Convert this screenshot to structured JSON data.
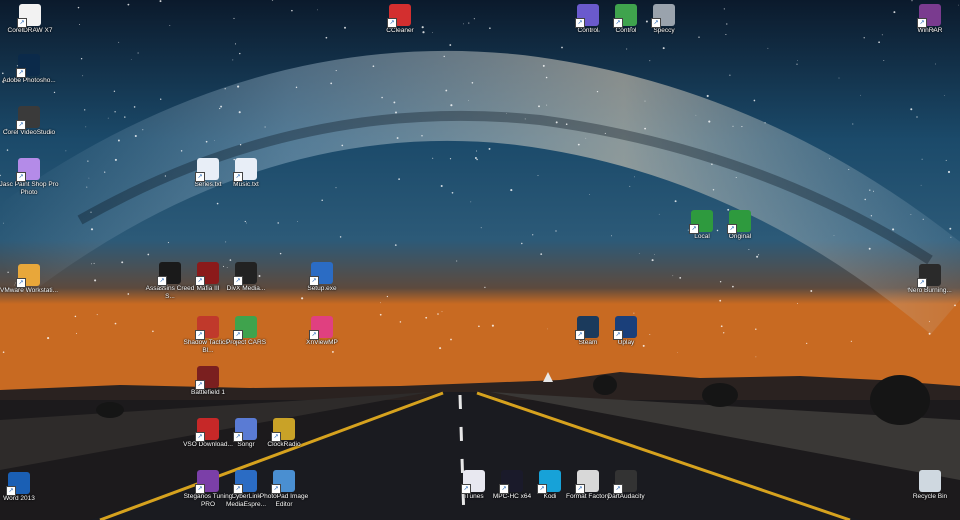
{
  "desktop": {
    "icons": [
      {
        "id": "coreldraw",
        "label": "CorelDRAW X7",
        "glyph": "document-icon",
        "color": "#f2f2f2"
      },
      {
        "id": "photoshop",
        "label": "Adobe Photosho...",
        "glyph": "photoshop-icon",
        "color": "#0b2a4a"
      },
      {
        "id": "videostudio",
        "label": "Corel VideoStudio",
        "glyph": "camera-icon",
        "color": "#3a3a3a"
      },
      {
        "id": "jasc",
        "label": "Jasc Paint Shop Pro Photo",
        "glyph": "sphere-icon",
        "color": "#b48be8"
      },
      {
        "id": "vmware",
        "label": "VMware Workstati...",
        "glyph": "vmware-icon",
        "color": "#e8a73a"
      },
      {
        "id": "word",
        "label": "Word 2013",
        "glyph": "word-icon",
        "color": "#1a5fb4"
      },
      {
        "id": "ccleaner",
        "label": "CCleaner",
        "glyph": "ccleaner-icon",
        "color": "#d32f2f"
      },
      {
        "id": "doc1",
        "label": "Series.txt",
        "glyph": "notepad-icon",
        "color": "#e8eef7"
      },
      {
        "id": "doc2",
        "label": "Music.txt",
        "glyph": "notepad-icon",
        "color": "#e8eef7"
      },
      {
        "id": "assassin",
        "label": "Assassins Creed S...",
        "glyph": "assassin-icon",
        "color": "#1a1a1a"
      },
      {
        "id": "mafia",
        "label": "Mafia III",
        "glyph": "mafia-icon",
        "color": "#8b1a1a"
      },
      {
        "id": "dxvid",
        "label": "DivX Media...",
        "glyph": "dx-icon",
        "color": "#222222"
      },
      {
        "id": "setup",
        "label": "Setup.exe",
        "glyph": "setup-icon",
        "color": "#2b6cc4"
      },
      {
        "id": "shadow",
        "label": "Shadow Tactics - Bl...",
        "glyph": "shadow-icon",
        "color": "#c0392b"
      },
      {
        "id": "projectcars",
        "label": "Project CARS",
        "glyph": "cars-icon",
        "color": "#3fa34d"
      },
      {
        "id": "xnview",
        "label": "XnViewMP",
        "glyph": "xn-icon",
        "color": "#e04080"
      },
      {
        "id": "battlefield",
        "label": "Battlefield 1",
        "glyph": "battlefield-icon",
        "color": "#7a1f1f"
      },
      {
        "id": "vso",
        "label": "VSO Download...",
        "glyph": "vso-icon",
        "color": "#c62828"
      },
      {
        "id": "songr",
        "label": "Songr",
        "glyph": "note-icon",
        "color": "#5a7bd4"
      },
      {
        "id": "clocky",
        "label": "ClockRadio",
        "glyph": "clock-icon",
        "color": "#c9a227"
      },
      {
        "id": "steganos",
        "label": "Steganos Tuning PRO",
        "glyph": "steganos-icon",
        "color": "#7b3fa8"
      },
      {
        "id": "cyberlink",
        "label": "CyberLink MediaEspre...",
        "glyph": "cyberlink-icon",
        "color": "#2b6cc4"
      },
      {
        "id": "photopad",
        "label": "PhotoPad Image Editor",
        "glyph": "photopad-icon",
        "color": "#4a8fd1"
      },
      {
        "id": "cpanel1",
        "label": "Control",
        "glyph": "controlpanel-icon",
        "color": "#6a5acd"
      },
      {
        "id": "cpanel2",
        "label": "Control",
        "glyph": "controlpanel-icon",
        "color": "#3fa34d"
      },
      {
        "id": "speccy",
        "label": "Speccy",
        "glyph": "speccy-icon",
        "color": "#9aa3ad"
      },
      {
        "id": "utorrent1",
        "label": "Local",
        "glyph": "utorrent-icon",
        "color": "#2e9a3e"
      },
      {
        "id": "utorrent2",
        "label": "Original",
        "glyph": "utorrent-icon",
        "color": "#2e9a3e"
      },
      {
        "id": "steam",
        "label": "Steam",
        "glyph": "steam-icon",
        "color": "#1b3a5c"
      },
      {
        "id": "uplay",
        "label": "Uplay",
        "glyph": "uplay-icon",
        "color": "#1a3f7a"
      },
      {
        "id": "itunes",
        "label": "iTunes",
        "glyph": "itunes-icon",
        "color": "#e8e8f0"
      },
      {
        "id": "mpchc",
        "label": "MPC-HC x64",
        "glyph": "mpc-icon",
        "color": "#1a1a2a"
      },
      {
        "id": "kodi",
        "label": "Kodi",
        "glyph": "kodi-icon",
        "color": "#17a2d8"
      },
      {
        "id": "formatfactory",
        "label": "Format Factory",
        "glyph": "formatfactory-icon",
        "color": "#d8d8d8"
      },
      {
        "id": "dartaudacity",
        "label": "DartAudacity",
        "glyph": "headphones-icon",
        "color": "#333333"
      },
      {
        "id": "winrar",
        "label": "WinRAR",
        "glyph": "winrar-icon",
        "color": "#7a3b8f"
      },
      {
        "id": "nero",
        "label": "Nero Burning...",
        "glyph": "nero-icon",
        "color": "#2a2a2a"
      },
      {
        "id": "recyclebin",
        "label": "Recycle Bin",
        "glyph": "recyclebin-icon",
        "color": "#cfd8e0"
      }
    ]
  }
}
